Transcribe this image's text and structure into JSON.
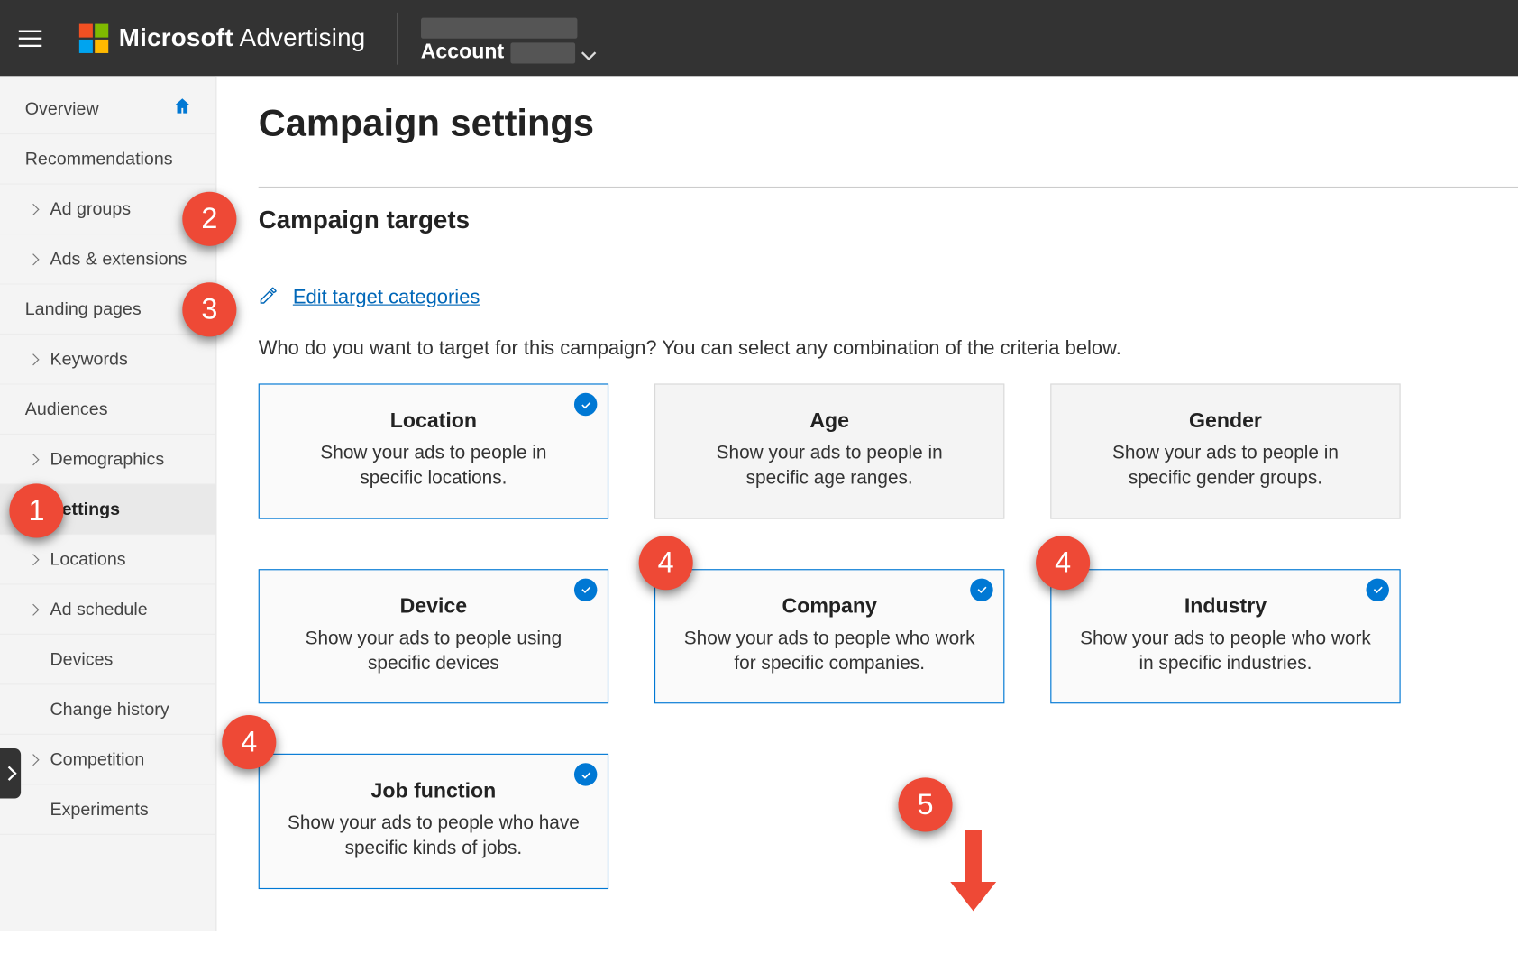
{
  "header": {
    "brand_bold": "Microsoft",
    "brand_light": "Advertising",
    "account_label": "Account"
  },
  "sidebar": {
    "items": [
      {
        "label": "Overview",
        "home": true
      },
      {
        "label": "Recommendations"
      },
      {
        "label": "Ad groups",
        "chev": true
      },
      {
        "label": "Ads & extensions",
        "chev": true
      },
      {
        "label": "Landing pages"
      },
      {
        "label": "Keywords",
        "chev": true
      },
      {
        "label": "Audiences"
      },
      {
        "label": "Demographics",
        "chev": true
      },
      {
        "label": "Settings",
        "active": true,
        "indent": true
      },
      {
        "label": "Locations",
        "chev": true
      },
      {
        "label": "Ad schedule",
        "chev": true
      },
      {
        "label": "Devices",
        "indent": true
      },
      {
        "label": "Change history",
        "indent": true
      },
      {
        "label": "Competition",
        "chev": true
      },
      {
        "label": "Experiments",
        "indent": true
      }
    ]
  },
  "page": {
    "title": "Campaign settings",
    "section_title": "Campaign targets",
    "edit_link": "Edit target categories",
    "help_text": "Who do you want to target for this campaign? You can select any combination of the criteria below."
  },
  "cards": [
    {
      "title": "Location",
      "desc": "Show your ads to people in specific locations.",
      "selected": true
    },
    {
      "title": "Age",
      "desc": "Show your ads to people in specific age ranges.",
      "selected": false
    },
    {
      "title": "Gender",
      "desc": "Show your ads to people in specific gender groups.",
      "selected": false
    },
    {
      "title": "Device",
      "desc": "Show your ads to people using specific devices",
      "selected": true
    },
    {
      "title": "Company",
      "desc": "Show your ads to people who work for specific companies.",
      "selected": true
    },
    {
      "title": "Industry",
      "desc": "Show your ads to people who work in specific industries.",
      "selected": true
    },
    {
      "title": "Job function",
      "desc": "Show your ads to people who have specific kinds of jobs.",
      "selected": true
    }
  ],
  "callouts": {
    "c1": "1",
    "c2": "2",
    "c3": "3",
    "c4a": "4",
    "c4b": "4",
    "c4c": "4",
    "c5": "5"
  }
}
